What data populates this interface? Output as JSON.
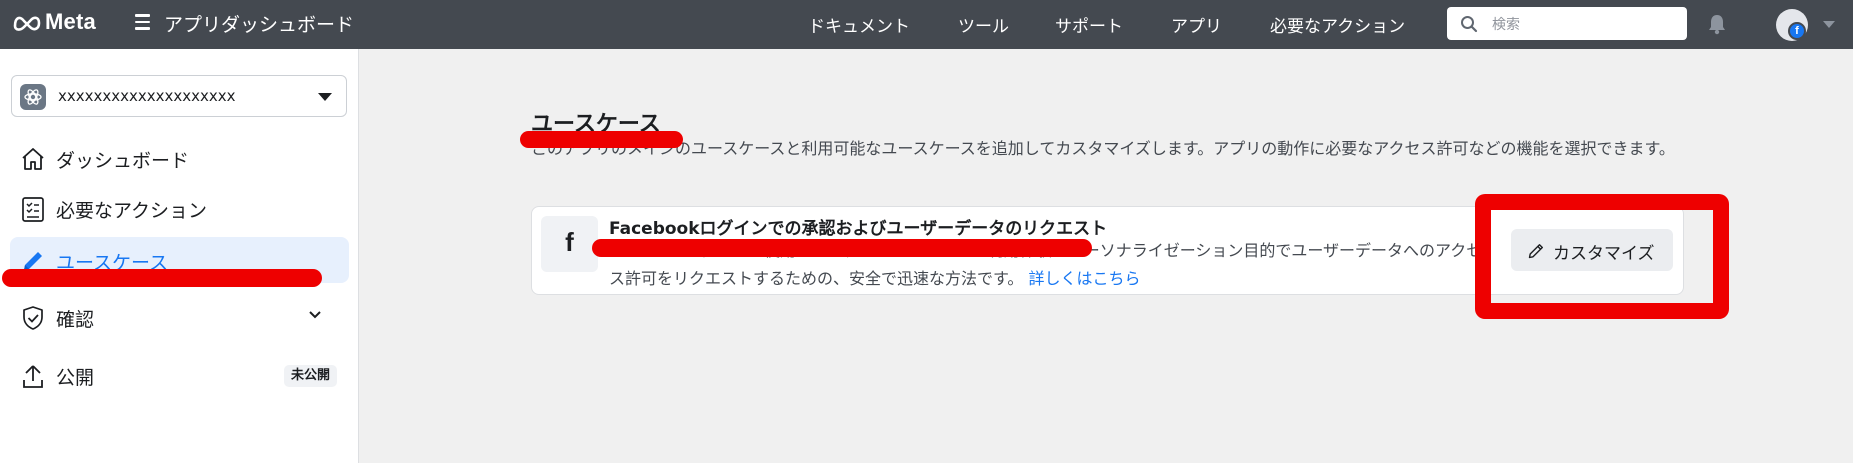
{
  "topbar": {
    "logo_text": "Meta",
    "app_title": "アプリダッシュボード",
    "nav": [
      "ドキュメント",
      "ツール",
      "サポート",
      "アプリ",
      "必要なアクション"
    ],
    "search_placeholder": "検索",
    "avatar_badge": "f"
  },
  "sidebar": {
    "app_name": "xxxxxxxxxxxxxxxxxxxx",
    "items": [
      {
        "label": "ダッシュボード",
        "icon": "home-icon"
      },
      {
        "label": "必要なアクション",
        "icon": "checklist-icon"
      },
      {
        "label": "ユースケース",
        "icon": "pencil-icon",
        "active": true
      },
      {
        "label": "確認",
        "icon": "shield-check-icon",
        "expandable": true
      },
      {
        "label": "公開",
        "icon": "upload-icon",
        "badge": "未公開"
      }
    ]
  },
  "main": {
    "title": "ユースケース",
    "description": "このアプリのメインのユースケースと利用可能なユースケースを追加してカスタマイズします。アプリの動作に必要なアクセス許可などの機能を選択できます。",
    "card": {
      "icon_letter": "f",
      "title": "Facebookログインでの承認およびユーザーデータのリクエスト",
      "description": "Facebookログインを使用してログインし、アプリが利用体験のパーソナライゼーション目的でユーザーデータへのアクセス許可をリクエストするための、安全で迅速な方法です。",
      "link": "詳しくはこちら",
      "button": "カスタマイズ"
    }
  },
  "colors": {
    "topbar": "#444950",
    "accent": "#1877f2",
    "annotation_red": "#ee0000",
    "active_bg": "#e7f0fd"
  }
}
